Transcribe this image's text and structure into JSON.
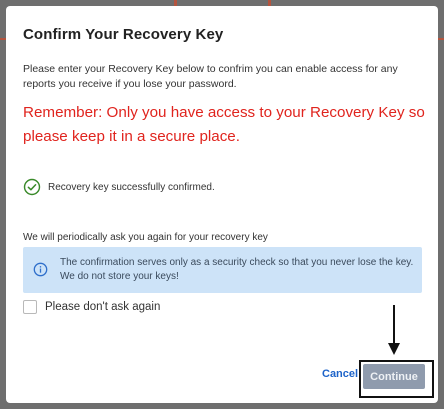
{
  "dialog": {
    "title": "Confirm Your Recovery Key",
    "intro": "Please enter your Recovery Key below to confrim you can enable access for any reports you receive if you lose your password.",
    "remember": "Remember: Only you have access to your Recovery Key so please keep it in a secure place.",
    "confirmed_text": "Recovery key successfully confirmed.",
    "periodic_text": "We will periodically ask you again for your recovery key",
    "notice_text": "The confirmation serves only as a security check so that you never lose the key. We do not store your keys!",
    "ask_label": "Please don't ask again",
    "ask_checked": false,
    "cancel_label": "Cancel",
    "continue_label": "Continue"
  },
  "colors": {
    "warning": "#e0241e",
    "success": "#3a8a2a",
    "notice_bg": "#cde3f8",
    "link": "#1d63c9",
    "disabled_button": "#8f9bad"
  },
  "icons": {
    "confirmed": "check-circle-icon",
    "notice": "info-circle-icon",
    "annotation": "arrow-down-icon"
  }
}
